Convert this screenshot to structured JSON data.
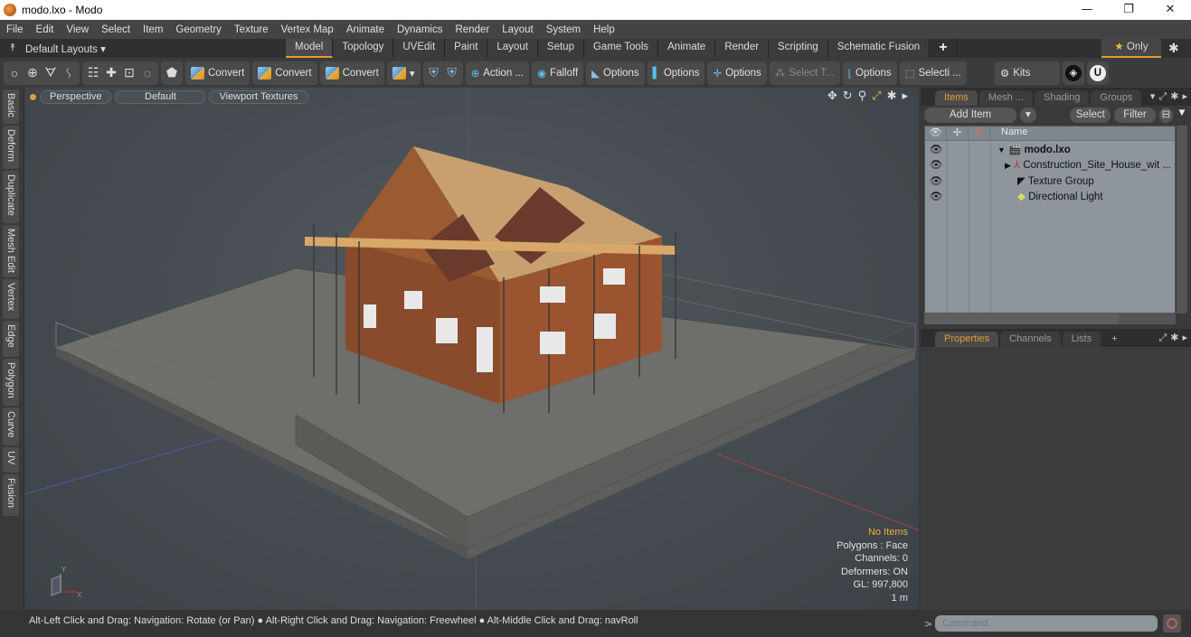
{
  "window": {
    "title": "modo.lxo - Modo",
    "controls": {
      "minimize": "—",
      "restore": "❐",
      "close": "✕"
    }
  },
  "menu": [
    "File",
    "Edit",
    "View",
    "Select",
    "Item",
    "Geometry",
    "Texture",
    "Vertex Map",
    "Animate",
    "Dynamics",
    "Render",
    "Layout",
    "System",
    "Help"
  ],
  "layoutbar": {
    "layouts_label": "Default Layouts ▾",
    "tabs": [
      "Model",
      "Topology",
      "UVEdit",
      "Paint",
      "Layout",
      "Setup",
      "Game Tools",
      "Animate",
      "Render",
      "Scripting",
      "Schematic Fusion"
    ],
    "active_tab": "Model",
    "add_tab": "+",
    "only_label": "Only"
  },
  "toolbar": {
    "buttons": [
      "Convert",
      "Convert",
      "Convert",
      "Action ...",
      "Falloff",
      "Options",
      "Options",
      "Options",
      "Select T...",
      "Options",
      "Selecti ...",
      "Kits"
    ]
  },
  "side_tabs": [
    "Basic",
    "Deform",
    "Duplicate",
    "Mesh Edit",
    "Vertex",
    "Edge",
    "Polygon",
    "Curve",
    "UV",
    "Fusion"
  ],
  "viewport": {
    "view_mode": "Perspective",
    "shading": "Default",
    "textures": "Viewport Textures",
    "info": {
      "selection": "No Items",
      "polygons": "Polygons : Face",
      "channels": "Channels: 0",
      "deformers": "Deformers: ON",
      "gl": "GL: 997,800",
      "scale": "1 m"
    },
    "axis": {
      "x": "X",
      "y": "Y"
    }
  },
  "items_panel": {
    "tabs": [
      "Items",
      "Mesh ...",
      "Shading",
      "Groups"
    ],
    "active_tab": "Items",
    "add_item": "Add Item",
    "select": "Select",
    "filter": "Filter",
    "column_name": "Name",
    "tree": [
      {
        "label": "modo.lxo",
        "level": 0,
        "expander": "▼",
        "bold": true,
        "icon": "scene-icon"
      },
      {
        "label": "Construction_Site_House_wit ...",
        "level": 1,
        "expander": "▶",
        "icon": "locator-icon"
      },
      {
        "label": "Texture Group",
        "level": 1,
        "expander": "",
        "icon": "texture-group-icon"
      },
      {
        "label": "Directional Light",
        "level": 1,
        "expander": "",
        "icon": "light-icon"
      }
    ]
  },
  "properties_panel": {
    "tabs": [
      "Properties",
      "Channels",
      "Lists"
    ],
    "active_tab": "Properties",
    "add": "+"
  },
  "status": {
    "hint": "Alt-Left Click and Drag: Navigation: Rotate (or Pan) ● Alt-Right Click and Drag: Navigation: Freewheel ● Alt-Middle Click and Drag: navRoll",
    "command_placeholder": "Command"
  },
  "colors": {
    "accent": "#e59a30",
    "tree_bg": "#8e959c"
  }
}
